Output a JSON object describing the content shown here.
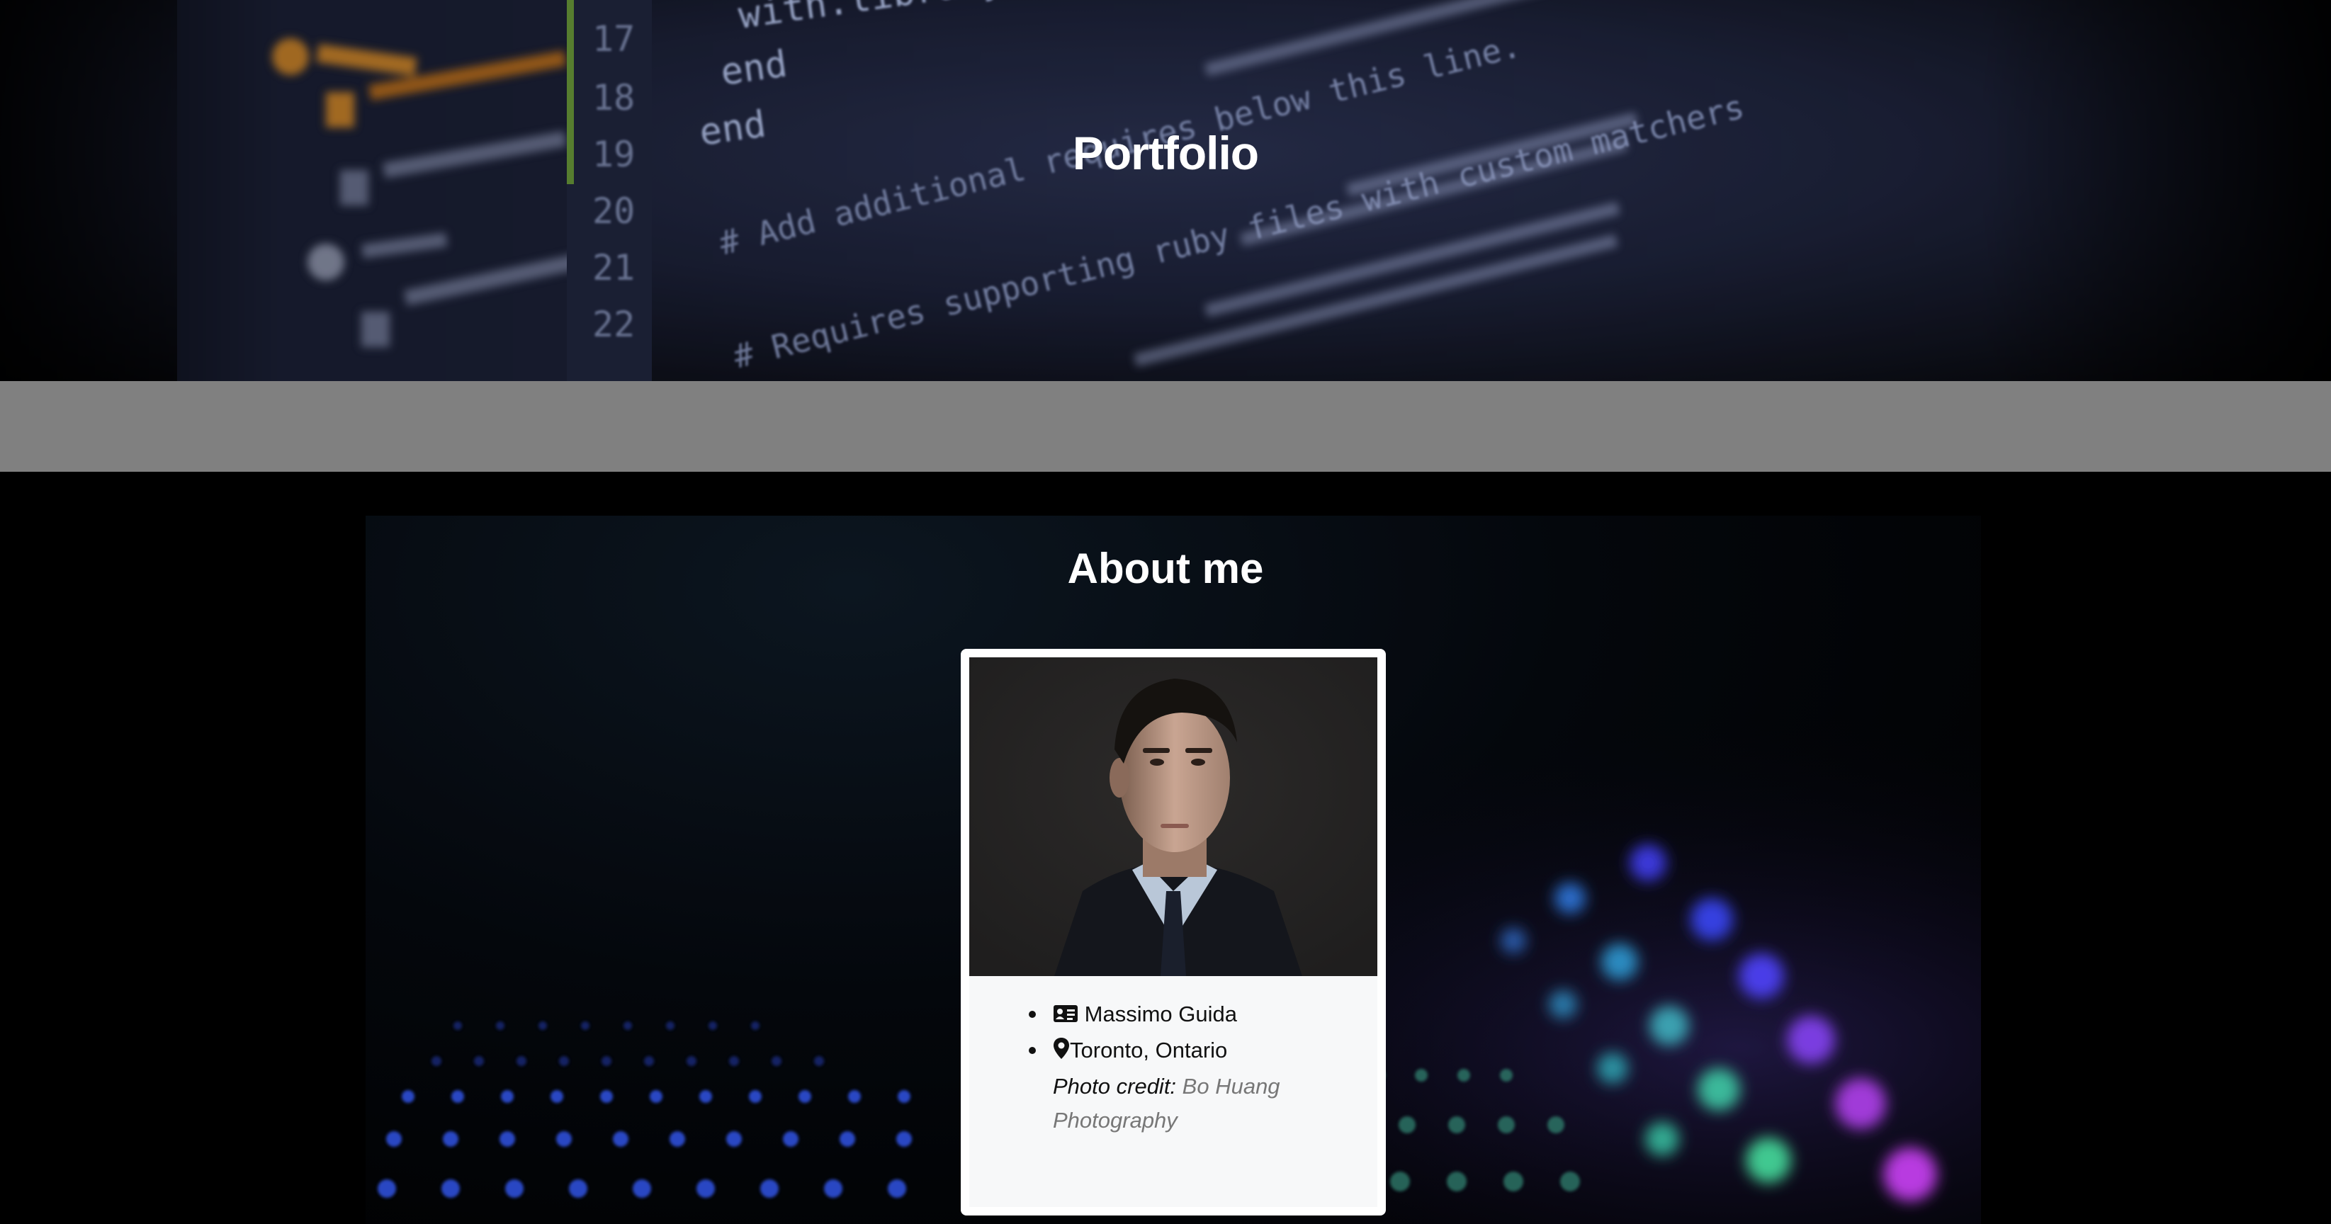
{
  "hero": {
    "title": "Portfolio"
  },
  "about": {
    "title": "About me",
    "name": "Massimo Guida",
    "location": "Toronto, Ontario",
    "credit_label": "Photo credit:",
    "credit_link_line1": "Bo Huang",
    "credit_link_line2": "Photography"
  },
  "icons": {
    "name": "id-card-icon",
    "location": "map-marker-icon"
  }
}
